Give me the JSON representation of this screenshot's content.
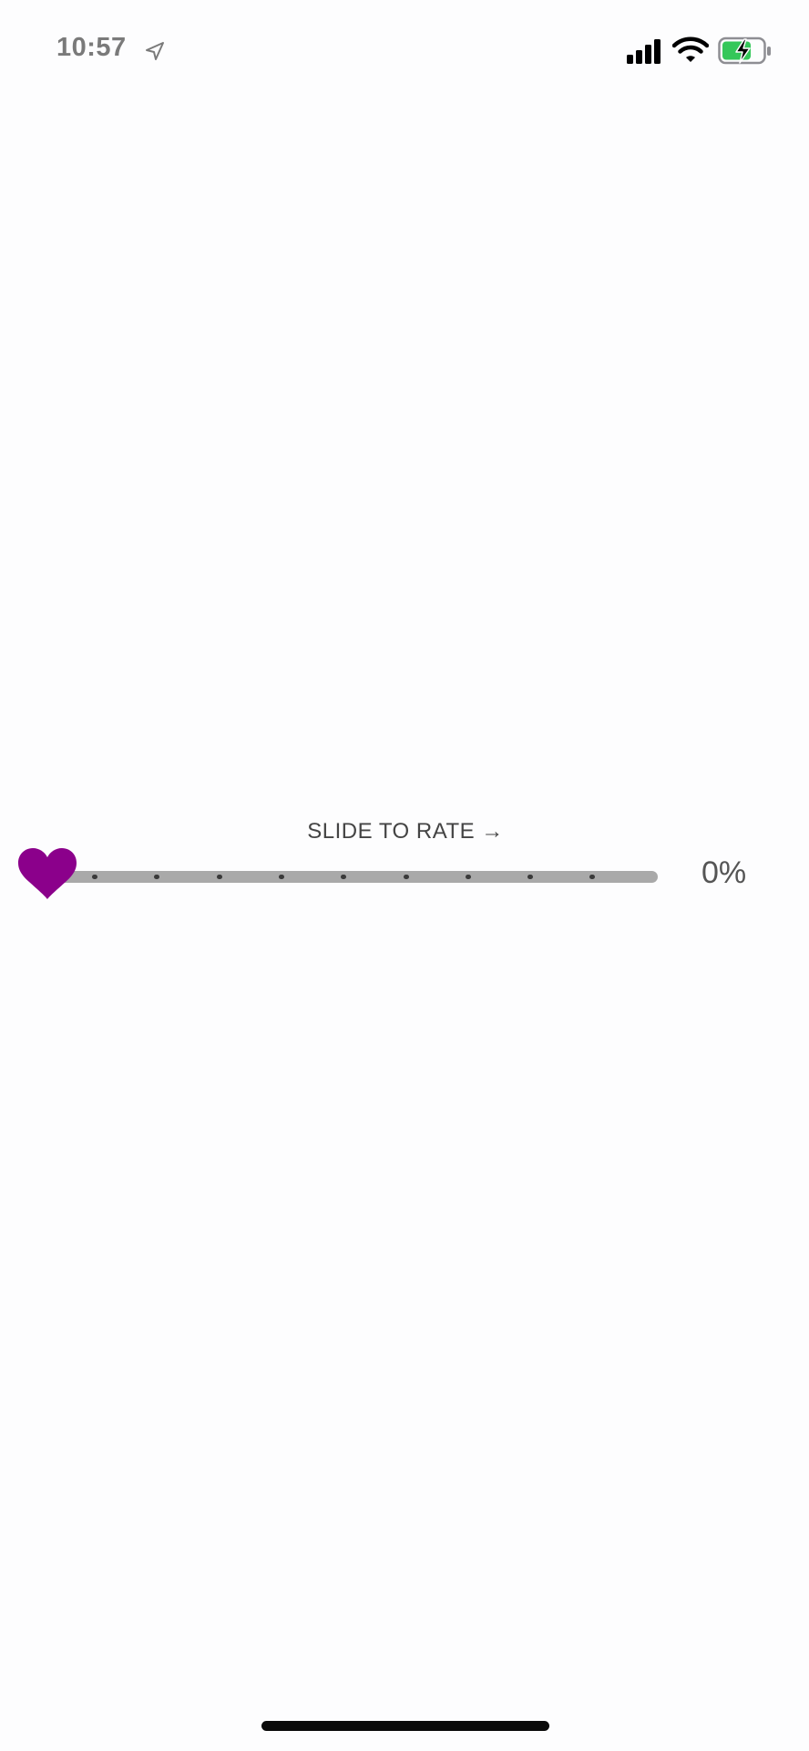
{
  "status_bar": {
    "time": "10:57",
    "icons": {
      "location": "location-arrow-icon",
      "signal": "cellular-signal-icon",
      "wifi": "wifi-icon",
      "battery": "battery-charging-icon"
    },
    "battery_color": "#34c759"
  },
  "rating": {
    "label": "SLIDE TO RATE →",
    "value_text": "0%",
    "value": 0,
    "tick_count": 9,
    "thumb_icon": "heart-icon",
    "thumb_color": "#8b008b",
    "track_color": "#a9a9a9"
  }
}
